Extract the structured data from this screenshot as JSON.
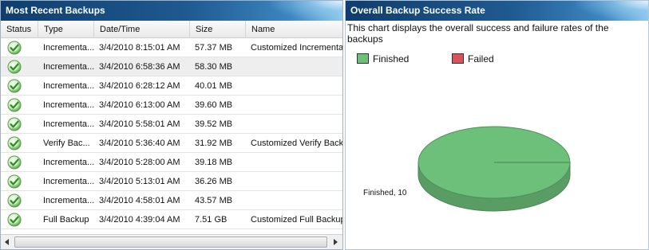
{
  "left_panel": {
    "title": "Most Recent Backups",
    "columns": [
      "Status",
      "Type",
      "Date/Time",
      "Size",
      "Name"
    ],
    "rows": [
      {
        "type": "Incrementa...",
        "datetime": "3/4/2010 8:15:01 AM",
        "size": "57.37 MB",
        "name": "Customized Incremental"
      },
      {
        "type": "Incrementa...",
        "datetime": "3/4/2010 6:58:36 AM",
        "size": "58.30 MB",
        "name": ""
      },
      {
        "type": "Incrementa...",
        "datetime": "3/4/2010 6:28:12 AM",
        "size": "40.01 MB",
        "name": ""
      },
      {
        "type": "Incrementa...",
        "datetime": "3/4/2010 6:13:00 AM",
        "size": "39.60 MB",
        "name": ""
      },
      {
        "type": "Incrementa...",
        "datetime": "3/4/2010 5:58:01 AM",
        "size": "39.52 MB",
        "name": ""
      },
      {
        "type": "Verify Bac...",
        "datetime": "3/4/2010 5:36:40 AM",
        "size": "31.92 MB",
        "name": "Customized Verify Back"
      },
      {
        "type": "Incrementa...",
        "datetime": "3/4/2010 5:28:00 AM",
        "size": "39.18 MB",
        "name": ""
      },
      {
        "type": "Incrementa...",
        "datetime": "3/4/2010 5:13:01 AM",
        "size": "36.26 MB",
        "name": ""
      },
      {
        "type": "Incrementa...",
        "datetime": "3/4/2010 4:58:01 AM",
        "size": "43.57 MB",
        "name": ""
      },
      {
        "type": "Full Backup",
        "datetime": "3/4/2010 4:39:04 AM",
        "size": "7.51 GB",
        "name": "Customized Full Backup"
      }
    ],
    "status_icon": "check-circle-icon",
    "status_color": "#4fa43d"
  },
  "right_panel": {
    "title": "Overall Backup Success Rate",
    "description": "This chart displays the overall success and failure rates of the backups"
  },
  "chart_data": {
    "type": "pie",
    "title": "",
    "series": [
      {
        "name": "Finished",
        "value": 10,
        "color": "#6cc07a"
      },
      {
        "name": "Failed",
        "value": 0,
        "color": "#d9545a"
      }
    ],
    "slice_label": "Finished, 10",
    "legend_position": "top-left",
    "style": "3d"
  },
  "colors": {
    "header_dark": "#0f3e6e",
    "header_light": "#8cc7ee",
    "selected_row": "#eeeeee"
  }
}
